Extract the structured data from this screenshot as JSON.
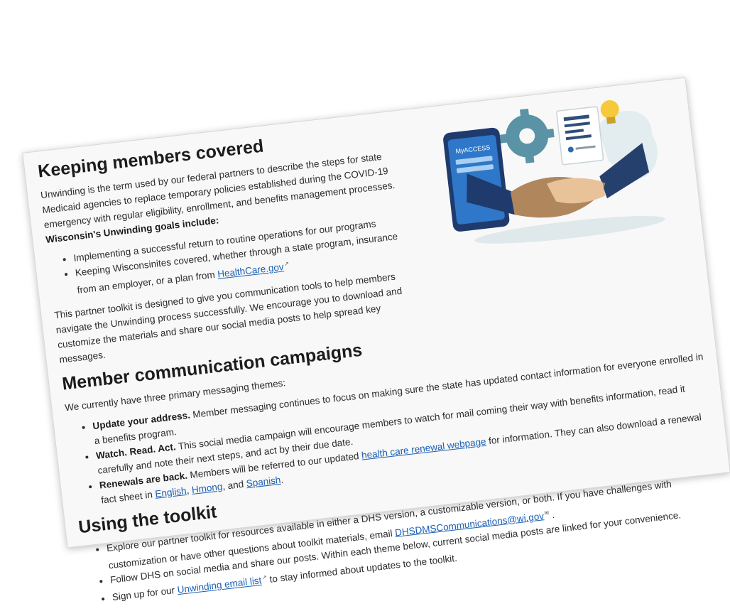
{
  "section1": {
    "title": "Keeping members covered",
    "intro_text": "Unwinding is the term used by our federal partners to describe the steps for state Medicaid agencies to replace temporary policies established during the COVID-19 emergency with regular eligibility, enrollment, and benefits management processes.",
    "goals_lead": "Wisconsin's Unwinding goals include:",
    "goal1": "Implementing a successful return to routine operations for our programs",
    "goal2_text": "Keeping Wisconsinites covered, whether through a state program, insurance from an employer, or a plan from",
    "goal2_link": "HealthCare.gov",
    "toolkit_text": "This partner toolkit is designed to give you communication tools to help members navigate the Unwinding process successfully. We encourage you to download and customize the materials and share our social media posts to help spread key messages."
  },
  "illustration": {
    "app_label": "MyACCESS"
  },
  "section2": {
    "title": "Member communication campaigns",
    "lead": "We currently have three primary messaging themes:",
    "item1_title": "Update your address.",
    "item1_text": "Member messaging continues to focus on making sure the state has updated contact information for everyone enrolled in a benefits program.",
    "item2_title": "Watch. Read. Act.",
    "item2_text": "This social media campaign will encourage members to watch for mail coming their way with benefits information, read it carefully and note their next steps, and act by their due date.",
    "item3_title": "Renewals are back.",
    "item3_text_a": "Members will be referred to our updated",
    "item3_link": "health care renewal webpage",
    "item3_text_b": "for information. They can also download a renewal fact sheet in",
    "lang1": "English",
    "sep1": ",",
    "lang2": "Hmong",
    "sep2": ", and",
    "lang3": "Spanish",
    "end": "."
  },
  "section3": {
    "title": "Using the toolkit",
    "item1_text": "Explore our partner toolkit for resources available in either a DHS version, a customizable version, or both. If you have challenges with customization or have other questions about toolkit materials, email",
    "item1_link": "DHSDMSCommunications@wi.gov",
    "item1_end": ".",
    "item2_text": "Follow DHS on social media and share our posts. Within each theme below, current social media posts are linked for your convenience.",
    "item3_text_a": "Sign up for our",
    "item3_link": "Unwinding email list",
    "item3_text_b": "to stay informed about updates to the toolkit."
  },
  "colors": {
    "link": "#1a5fb4",
    "phone": "#1f3b6e",
    "gear": "#5a93a5",
    "bulb": "#f6c93c"
  }
}
